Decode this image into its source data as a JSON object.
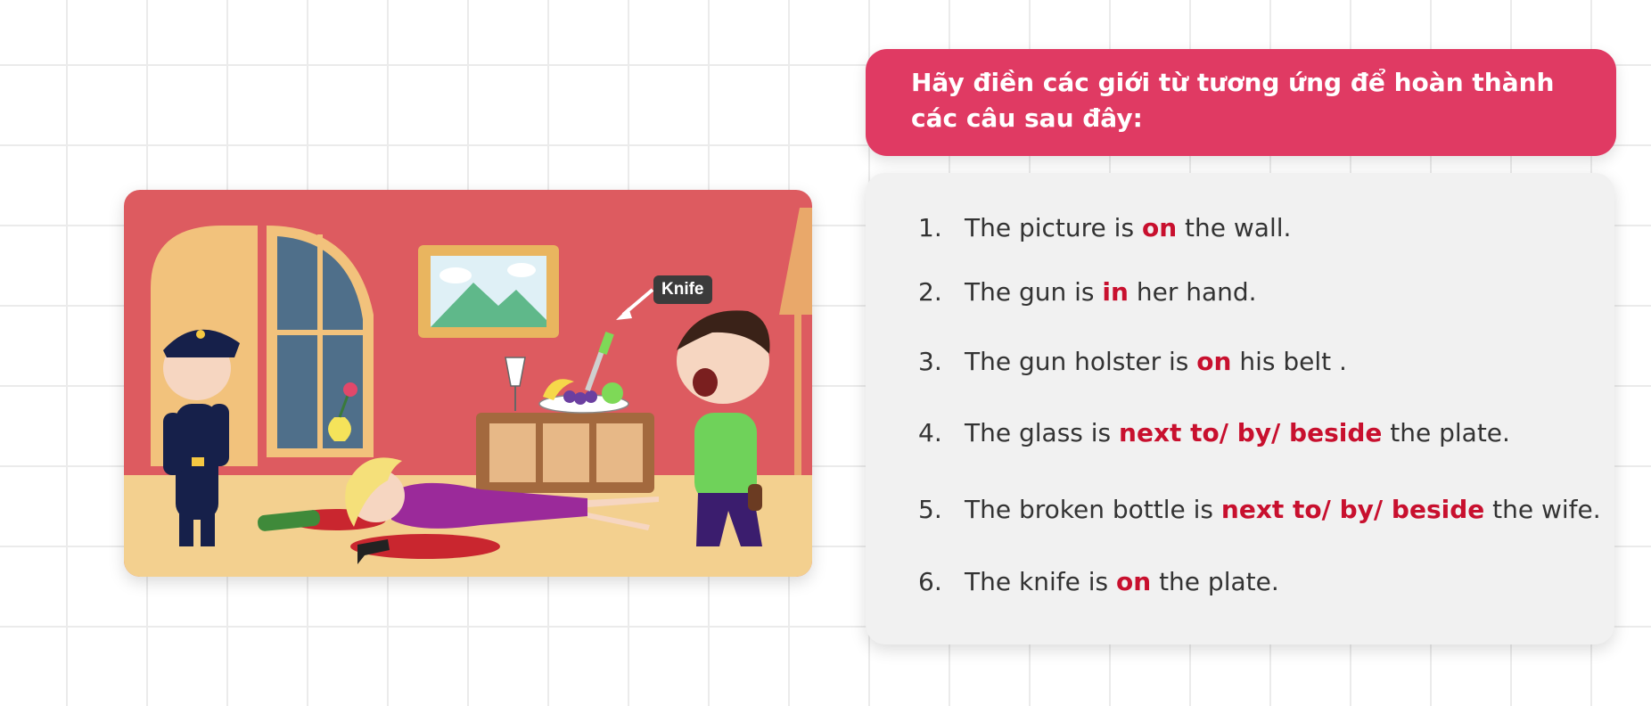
{
  "illustration": {
    "knife_label": "Knife"
  },
  "instruction": {
    "title": "Hãy điền các giới từ tương ứng để hoàn thành các câu sau đây:"
  },
  "exercises": [
    {
      "num": "1.",
      "before": "The picture is",
      "answer": "on",
      "after": "the wall."
    },
    {
      "num": "2.",
      "before": "The gun is",
      "answer": "in",
      "after": "her hand."
    },
    {
      "num": "3.",
      "before": "The gun holster is",
      "answer": "on",
      "after": "his belt ."
    },
    {
      "num": "4.",
      "before": "The glass is",
      "answer": "next to/ by/ beside",
      "after": "the plate."
    },
    {
      "num": "5.",
      "before": "The broken bottle is",
      "answer": "next to/ by/ beside",
      "after": "the wife."
    },
    {
      "num": "6.",
      "before": "The knife is",
      "answer": "on",
      "after": "the plate."
    }
  ],
  "colors": {
    "title_bg": "#e03a63",
    "answer": "#c8102e",
    "wall": "#dd5b60",
    "floor": "#f3d08f"
  }
}
